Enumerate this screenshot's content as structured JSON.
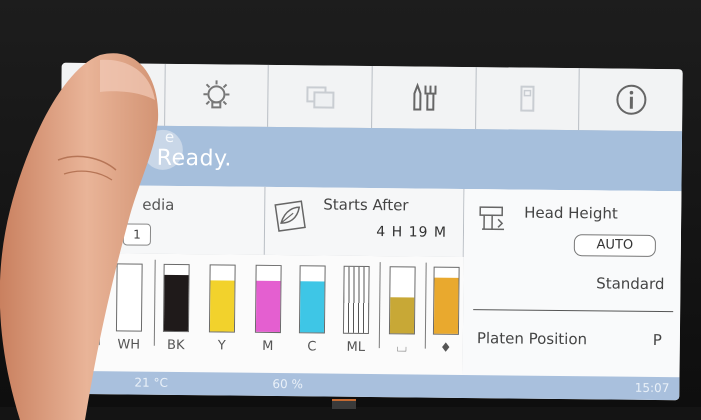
{
  "status": {
    "sub_label": "e",
    "main_label": "Ready."
  },
  "media": {
    "label": "edia",
    "number": "1"
  },
  "starts": {
    "label": "Starts After",
    "value": "4 H   19 M"
  },
  "head": {
    "label": "Head Height",
    "auto_button": "AUTO",
    "mode": "Standard"
  },
  "platen": {
    "label": "Platen Position",
    "value": "P"
  },
  "inks": [
    {
      "label": "WH",
      "color": "#ffffff",
      "level": 0.0
    },
    {
      "label": "WH",
      "color": "#ffffff",
      "level": 0.0
    },
    {
      "label": "BK",
      "color": "#1f1a1a",
      "level": 0.85
    },
    {
      "label": "Y",
      "color": "#f2d22c",
      "level": 0.78
    },
    {
      "label": "M",
      "color": "#e45fd0",
      "level": 0.78
    },
    {
      "label": "C",
      "color": "#3ec6e6",
      "level": 0.78
    },
    {
      "label": "ML",
      "color": "#ffffff",
      "level": 0.0
    },
    {
      "label": "",
      "color": "#c8a836",
      "level": 0.55
    },
    {
      "label": "",
      "color": "#e9a92e",
      "level": 0.85
    }
  ],
  "footer": {
    "temperature": "21 °C",
    "humidity": "60 %",
    "time": "15:07"
  }
}
